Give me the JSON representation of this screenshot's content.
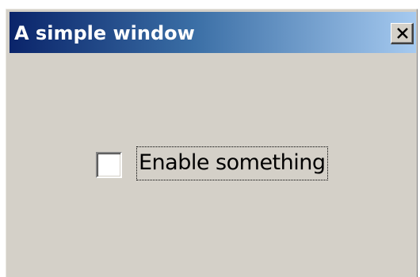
{
  "window": {
    "title": "A simple window",
    "close_icon": "close-icon"
  },
  "checkbox": {
    "label": "Enable something",
    "checked": false
  }
}
